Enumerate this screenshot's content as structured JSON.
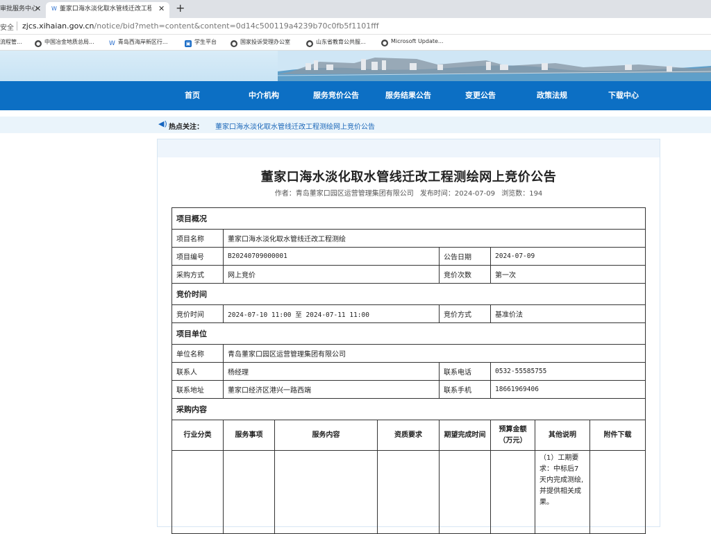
{
  "browser": {
    "tabs": [
      {
        "label": "审批服务中心"
      },
      {
        "label": "董家口海水淡化取水管线迁改工程测绘网上竞价公告"
      }
    ],
    "security_label": "安全",
    "url_host": "zjcs.xihaian.gov.cn",
    "url_path": "/notice/bid?meth=content&content=0d14c500119a4239b70c0fb5f1101fff",
    "bookmarks": [
      {
        "label": "流程管...",
        "icon": "globe-icon"
      },
      {
        "label": "中国冶金地质总局...",
        "icon": "globe-icon"
      },
      {
        "label": "青岛西海岸新区行...",
        "icon": "site-icon"
      },
      {
        "label": "学生平台",
        "icon": "app-icon"
      },
      {
        "label": "国家投诉受理办公室",
        "icon": "globe-icon"
      },
      {
        "label": "山东省教育公共服...",
        "icon": "globe-icon"
      },
      {
        "label": "Microsoft Update...",
        "icon": "globe-icon"
      }
    ]
  },
  "nav": {
    "items": [
      "首页",
      "中介机构",
      "服务竞价公告",
      "服务结果公告",
      "变更公告",
      "政策法规",
      "下载中心"
    ]
  },
  "hot": {
    "label": "热点关注：",
    "link": "董家口海水淡化取水管线迁改工程测绘网上竞价公告"
  },
  "article": {
    "title": "董家口海水淡化取水管线迁改工程测绘网上竞价公告",
    "author": "作者：青岛董家口园区运营管理集团有限公司",
    "published": "发布时间：2024-07-09",
    "views": "浏览数：194"
  },
  "info": {
    "section_overview": "项目概况",
    "project_name_label": "项目名称",
    "project_name": "董家口海水淡化取水管线迁改工程测绘",
    "project_no_label": "项目编号",
    "project_no": "B20240709000001",
    "notice_date_label": "公告日期",
    "notice_date": "2024-07-09",
    "purchase_method_label": "采购方式",
    "purchase_method": "网上竞价",
    "bid_round_label": "竞价次数",
    "bid_round": "第一次",
    "section_time": "竞价时间",
    "bid_time_label": "竞价时间",
    "bid_time": "2024-07-10 11:00 至 2024-07-11 11:00",
    "bid_mode_label": "竞价方式",
    "bid_mode": "基准价法",
    "section_unit": "项目单位",
    "unit_name_label": "单位名称",
    "unit_name": "青岛董家口园区运营管理集团有限公司",
    "contact_label": "联系人",
    "contact": "杨经理",
    "phone_label": "联系电话",
    "phone": "0532-55585755",
    "address_label": "联系地址",
    "address": "董家口经济区港兴一路西端",
    "mobile_label": "联系手机",
    "mobile": "18661969406",
    "section_content": "采购内容",
    "headers": [
      "行业分类",
      "服务事项",
      "服务内容",
      "资质要求",
      "期望完成时间",
      "预算金额（万元）",
      "其他说明",
      "附件下载"
    ],
    "other_note": "（1）工期要求：中标后7天内完成测绘,并提供相关成果。"
  }
}
